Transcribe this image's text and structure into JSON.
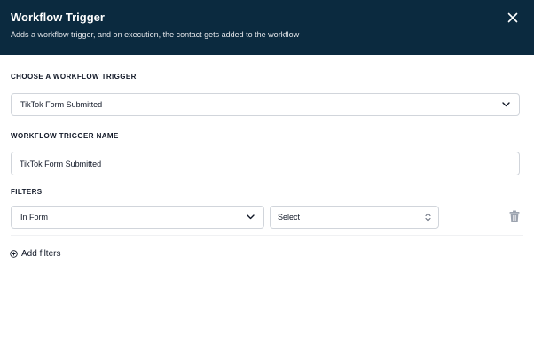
{
  "header": {
    "title": "Workflow Trigger",
    "subtitle": "Adds a workflow trigger, and on execution, the contact gets added to the workflow"
  },
  "trigger_select": {
    "label": "CHOOSE A WORKFLOW TRIGGER",
    "value": "TikTok Form Submitted"
  },
  "trigger_name": {
    "label": "WORKFLOW TRIGGER NAME",
    "value": "TikTok Form Submitted"
  },
  "filters": {
    "label": "FILTERS",
    "field_value": "In Form",
    "option_value": "Select",
    "add_label": "Add filters"
  },
  "icons": {
    "close": "close-icon",
    "chevron": "chevron-down-icon",
    "updown": "chevron-up-down-icon",
    "trash": "trash-icon",
    "add": "plus-circle-icon"
  },
  "colors": {
    "header_bg": "#0b2a3f",
    "border": "#d1d5db",
    "icon_gray": "#9ca3af"
  }
}
